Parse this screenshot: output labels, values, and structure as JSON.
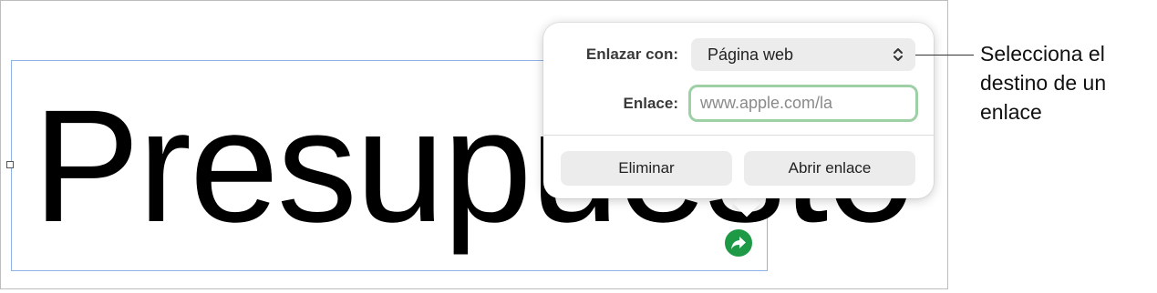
{
  "document": {
    "text": "Presupuesto"
  },
  "popover": {
    "link_to_label": "Enlazar con:",
    "link_to_value": "Página web",
    "link_label": "Enlace:",
    "link_value": "www.apple.com/la",
    "delete_button": "Eliminar",
    "open_button": "Abrir enlace"
  },
  "callout": {
    "text": "Selecciona el destino de un enlace"
  },
  "icons": {
    "link_badge": "arrow-redirect-icon",
    "select_chevron": "chevron-up-down-icon"
  },
  "colors": {
    "link_badge": "#1e9a47",
    "input_focus_ring": "#9ed0a6",
    "selection_border": "#8fb2e8"
  }
}
